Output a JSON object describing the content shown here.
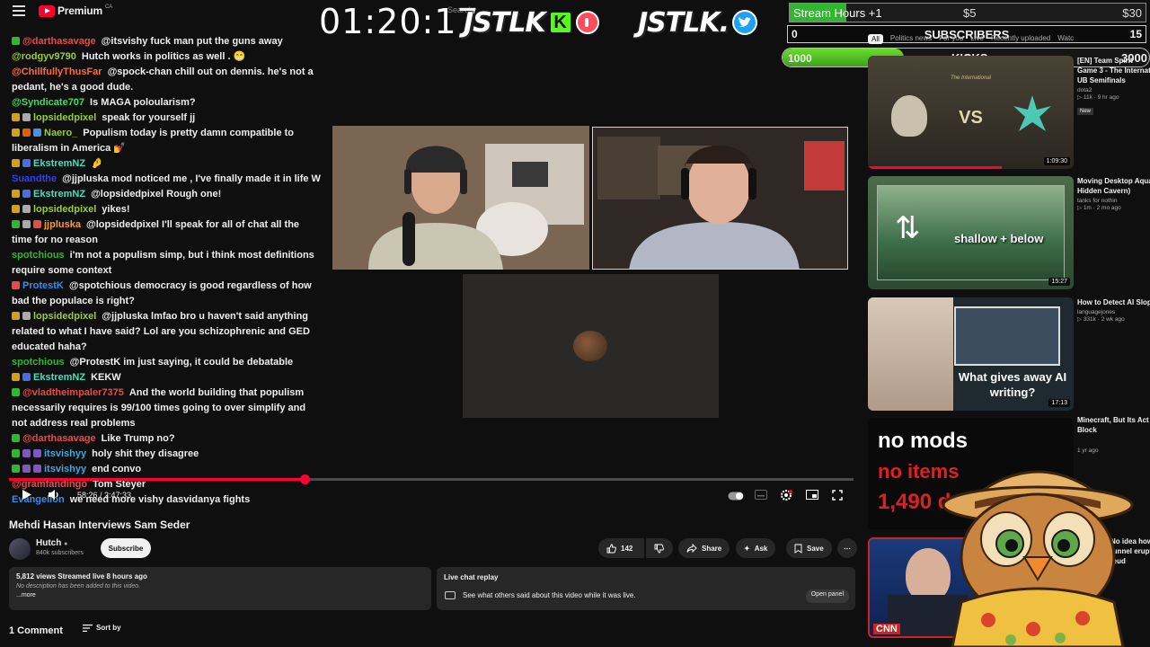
{
  "header": {
    "logo_text": "Premium",
    "logo_region": "CA",
    "search_placeholder": "Search",
    "timer": "01:20:17"
  },
  "brand": {
    "name_1": "JSTLK",
    "kick_letter": "K",
    "name_2": "JSTLK."
  },
  "overlay": {
    "stream_hours": {
      "label": "Stream Hours +1",
      "mark_1": "$5",
      "mark_2": "$30",
      "progress": 0.16
    },
    "subscribers": {
      "current": "0",
      "label": "SUBSCRIBERS",
      "goal": "15"
    },
    "kicks": {
      "current": "1000",
      "label": "KICKS",
      "goal": "3000",
      "progress": 0.33
    },
    "chips": [
      "All",
      "Politics news",
      "For you",
      "Live",
      "Recently uploaded",
      "Watc"
    ]
  },
  "chat": [
    {
      "user": "@darthasavage",
      "color": "#e64a4a",
      "badges": [
        "#2eb82e"
      ],
      "text": "@itsvishy fuck man put the guns away"
    },
    {
      "user": "@rodgyv9790",
      "color": "#9acd32",
      "badges": [],
      "text": "Hutch works in politics as well . 😁"
    },
    {
      "user": "@ChillfullyThusFar",
      "color": "#ff6b3d",
      "badges": [],
      "text": "@spock-chan chill out on dennis. he's not a pedant, he's a good dude."
    },
    {
      "user": "@Syndicate707",
      "color": "#3ee05d",
      "badges": [],
      "text": "Is MAGA poloularism?"
    },
    {
      "user": "lopsidedpixel",
      "color": "#9acd32",
      "badges": [
        "#d4a017",
        "#aaaaaa"
      ],
      "text": "speak for yourself jj"
    },
    {
      "user": "Naero_",
      "color": "#9acd32",
      "badges": [
        "#d4a017",
        "#e65c00",
        "#4a90e2"
      ],
      "text": "Populism today is pretty damn compatible to liberalism in America 💅"
    },
    {
      "user": "EkstremNZ",
      "color": "#3ee0c0",
      "badges": [
        "#d4a017",
        "#4a6ee2"
      ],
      "text": "🤌"
    },
    {
      "user": "Suandthe",
      "color": "#2f3fff",
      "badges": [],
      "text": "@jjpluska mod noticed me , I've finally made it in life W"
    },
    {
      "user": "EkstremNZ",
      "color": "#3ee0c0",
      "badges": [
        "#d4a017",
        "#4a6ee2"
      ],
      "text": "@lopsidedpixel Rough one!"
    },
    {
      "user": "lopsidedpixel",
      "color": "#9acd32",
      "badges": [
        "#d4a017",
        "#aaaaaa"
      ],
      "text": "yikes!"
    },
    {
      "user": "jjpluska",
      "color": "#ff9933",
      "badges": [
        "#2eb82e",
        "#aaaaaa",
        "#e64a4a"
      ],
      "text": "@lopsidedpixel I'll speak for all of chat all the time for no reason"
    },
    {
      "user": "spotchious",
      "color": "#2eb82e",
      "badges": [],
      "text": "i'm not a populism simp, but i think most definitions require some context"
    },
    {
      "user": "ProtestK",
      "color": "#3c8ce6",
      "badges": [
        "#e64a4a"
      ],
      "text": "@spotchious democracy is good regardless of how bad the populace is right?"
    },
    {
      "user": "lopsidedpixel",
      "color": "#9acd32",
      "badges": [
        "#d4a017",
        "#aaaaaa"
      ],
      "text": "@jjpluska lmfao bro u haven't said anything related to what I have said? Lol are you schizophrenic and GED educated haha?"
    },
    {
      "user": "spotchious",
      "color": "#2eb82e",
      "badges": [],
      "text": "@ProtestK im just saying, it could be debatable"
    },
    {
      "user": "EkstremNZ",
      "color": "#3ee0c0",
      "badges": [
        "#d4a017",
        "#4a6ee2"
      ],
      "text": "KEKW"
    },
    {
      "user": "@vladtheimpaler7375",
      "color": "#e64a4a",
      "badges": [
        "#2eb82e"
      ],
      "text": "And the world building that populism necessarily requires is 99/100 times going to over simplify and not address real problems"
    },
    {
      "user": "@darthasavage",
      "color": "#e64a4a",
      "badges": [
        "#2eb82e"
      ],
      "text": "Like Trump no?"
    },
    {
      "user": "itsvishyy",
      "color": "#3ea7e0",
      "badges": [
        "#2eb82e",
        "#7e57c2",
        "#7e57c2"
      ],
      "text": "holy shit they disagree"
    },
    {
      "user": "itsvishyy",
      "color": "#3ea7e0",
      "badges": [
        "#2eb82e",
        "#7e57c2",
        "#7e57c2"
      ],
      "text": "end convo"
    },
    {
      "user": "@gramfandingo",
      "color": "#e64a4a",
      "badges": [],
      "text": "Tom Steyer"
    },
    {
      "user": "Evangelion",
      "color": "#3c8ce6",
      "badges": [],
      "text": "we need more vishy dasvidanya fights"
    }
  ],
  "player": {
    "time_display": "58:26 / 2:47:33",
    "progress": 0.35
  },
  "video": {
    "title": "Mehdi Hasan Interviews Sam Seder",
    "channel": "Hutch",
    "subscribers": "840k subscribers",
    "subscribe_label": "Subscribe",
    "likes": "142",
    "share_label": "Share",
    "ask_label": "Ask",
    "save_label": "Save",
    "description_stats": "5,812 views  Streamed live 8 hours ago",
    "description_text": "No description has been added to this video.",
    "description_more": "...more",
    "replay_title": "Live chat replay",
    "replay_text": "See what others said about this video while it was live.",
    "open_panel_label": "Open panel",
    "comments_count": "1 Comment",
    "sort_label": "Sort by"
  },
  "recommendations": [
    {
      "title": "[EN] Team Spirit",
      "title2": "Game 3 - The Internat",
      "title3": "UB Semifinals",
      "channel": "dota2",
      "views": "11k",
      "age": "9 hr ago",
      "badge": "New",
      "duration": "1:09:30",
      "thumb_text": "VS",
      "thumb_caption": "The International"
    },
    {
      "title": "Moving Desktop Aqua",
      "title2": "Hidden Cavern)",
      "channel": "tanks for nothin",
      "views": "1m",
      "age": "2 mo ago",
      "duration": "15:27",
      "thumb_text": "shallow + below"
    },
    {
      "title": "How to Detect AI Slop",
      "channel": "languagejones",
      "views": "331k",
      "age": "2 wk ago",
      "duration": "17:13",
      "thumb_text": "What gives away AI writing?"
    },
    {
      "title": "Minecraft, But Its Act",
      "title2": "Block",
      "channel": "",
      "views": "",
      "age": "1 yr ago",
      "thumb_text_1": "no mods",
      "thumb_text_2": "no items",
      "thumb_text_3": "1,490 da"
    },
    {
      "title": "No idea how",
      "title2": "tunnel erupts",
      "title3": "feud",
      "thumb_text": "CNN"
    }
  ]
}
